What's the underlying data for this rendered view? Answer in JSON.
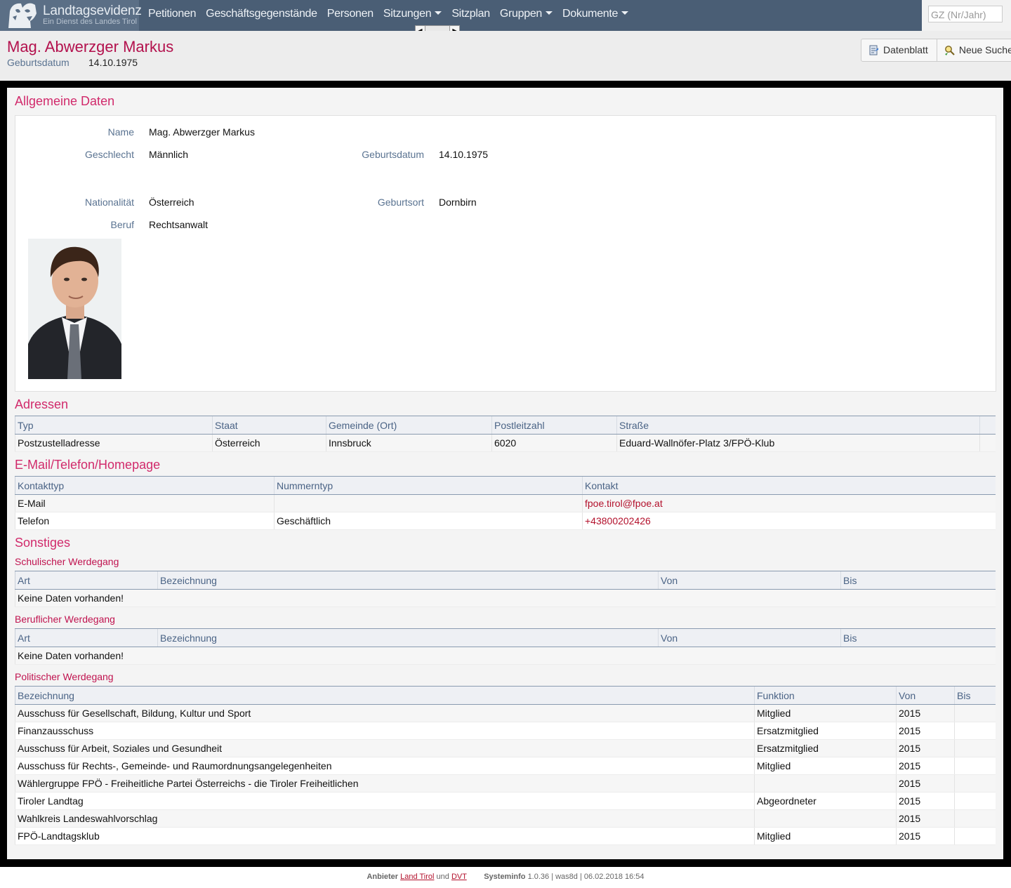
{
  "app": {
    "name": "Landtagsevidenz",
    "subtitle": "Ein Dienst des Landes Tirol"
  },
  "nav": [
    {
      "label": "Petitionen",
      "dropdown": false
    },
    {
      "label": "Geschäftsgegenstände",
      "dropdown": false
    },
    {
      "label": "Personen",
      "dropdown": false
    },
    {
      "label": "Sitzungen",
      "dropdown": true
    },
    {
      "label": "Sitzplan",
      "dropdown": false
    },
    {
      "label": "Gruppen",
      "dropdown": true
    },
    {
      "label": "Dokumente",
      "dropdown": true
    }
  ],
  "search": {
    "placeholder": "GZ (Nr/Jahr)"
  },
  "header": {
    "title": "Mag. Abwerzger Markus",
    "birth_label": "Geburtsdatum",
    "birth_value": "14.10.1975",
    "buttons": {
      "datenblatt": "Datenblatt",
      "neue_suche": "Neue Suche"
    }
  },
  "general": {
    "heading": "Allgemeine Daten",
    "name_label": "Name",
    "name_value": "Mag. Abwerzger Markus",
    "gender_label": "Geschlecht",
    "gender_value": "Männlich",
    "birthdate_label": "Geburtsdatum",
    "birthdate_value": "14.10.1975",
    "nationality_label": "Nationalität",
    "nationality_value": "Österreich",
    "birthplace_label": "Geburtsort",
    "birthplace_value": "Dornbirn",
    "job_label": "Beruf",
    "job_value": "Rechtsanwalt"
  },
  "addresses": {
    "heading": "Adressen",
    "columns": [
      "Typ",
      "Staat",
      "Gemeinde (Ort)",
      "Postleitzahl",
      "Straße",
      ""
    ],
    "rows": [
      [
        "Postzustelladresse",
        "Österreich",
        "Innsbruck",
        "6020",
        "Eduard-Wallnöfer-Platz 3/FPÖ-Klub",
        ""
      ]
    ]
  },
  "contacts": {
    "heading": "E-Mail/Telefon/Homepage",
    "columns": [
      "Kontakttyp",
      "Nummerntyp",
      "Kontakt"
    ],
    "rows": [
      [
        "E-Mail",
        "",
        "fpoe.tirol@fpoe.at"
      ],
      [
        "Telefon",
        "Geschäftlich",
        "+43800202426"
      ]
    ]
  },
  "misc": {
    "heading": "Sonstiges",
    "school": {
      "heading": "Schulischer Werdegang",
      "columns": [
        "Art",
        "Bezeichnung",
        "Von",
        "Bis"
      ],
      "empty": "Keine Daten vorhanden!"
    },
    "career": {
      "heading": "Beruflicher Werdegang",
      "columns": [
        "Art",
        "Bezeichnung",
        "Von",
        "Bis"
      ],
      "empty": "Keine Daten vorhanden!"
    },
    "political": {
      "heading": "Politischer Werdegang",
      "columns": [
        "Bezeichnung",
        "Funktion",
        "Von",
        "Bis"
      ],
      "rows": [
        [
          "Ausschuss für Gesellschaft, Bildung, Kultur und Sport",
          "Mitglied",
          "2015",
          ""
        ],
        [
          "Finanzausschuss",
          "Ersatzmitglied",
          "2015",
          ""
        ],
        [
          "Ausschuss für Arbeit, Soziales und Gesundheit",
          "Ersatzmitglied",
          "2015",
          ""
        ],
        [
          "Ausschuss für Rechts-, Gemeinde- und Raumordnungsangelegenheiten",
          "Mitglied",
          "2015",
          ""
        ],
        [
          "Wählergruppe FPÖ - Freiheitliche Partei Österreichs - die Tiroler Freiheitlichen",
          "",
          "2015",
          ""
        ],
        [
          "Tiroler Landtag",
          "Abgeordneter",
          "2015",
          ""
        ],
        [
          "Wahlkreis Landeswahlvorschlag",
          "",
          "2015",
          ""
        ],
        [
          "FPÖ-Landtagsklub",
          "Mitglied",
          "2015",
          ""
        ]
      ]
    }
  },
  "footer": {
    "provider_label": "Anbieter",
    "provider1": "Land Tirol",
    "and": "und",
    "provider2": "DVT",
    "sysinfo_label": "Systeminfo",
    "sysinfo_value": "1.0.36 | was8d | 06.02.2018 16:54"
  },
  "colors": {
    "nav_bg": "#4a5e75",
    "accent": "#d12a6b",
    "title": "#b3114d",
    "label": "#5a7391",
    "link": "#b3112c"
  }
}
